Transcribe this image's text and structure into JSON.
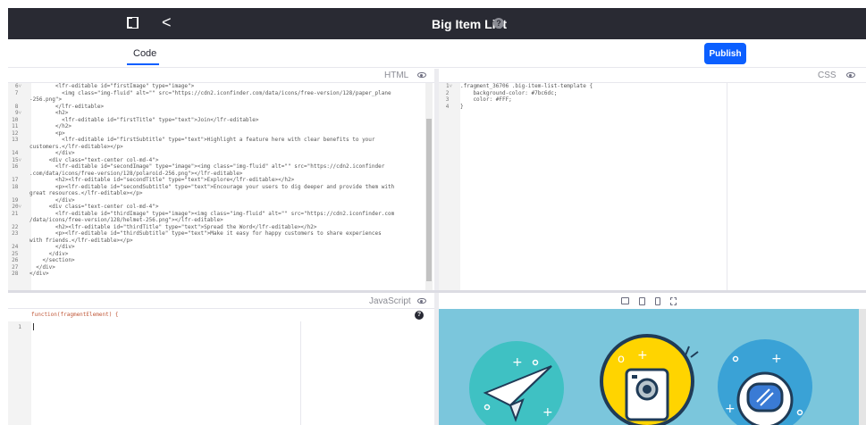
{
  "topbar": {
    "title": "Big Item List",
    "toggle_icon": "sidebar-toggle-icon",
    "back_icon": "chevron-left-icon",
    "back_glyph": "<",
    "help_icon": "question-circle-icon",
    "help_glyph": "?"
  },
  "tabs": [
    {
      "label": "Code",
      "active": true
    }
  ],
  "publish_label": "Publish",
  "panes": {
    "html": {
      "label": "HTML"
    },
    "css": {
      "label": "CSS"
    },
    "js": {
      "label": "JavaScript"
    }
  },
  "html_code": [
    {
      "n": "6",
      "fold": true,
      "t": "        <lfr-editable id=\"firstImage\" type=\"image\">"
    },
    {
      "n": "7",
      "fold": false,
      "t": "          <img class=\"img-fluid\" alt=\"\" src=\"https://cdn2.iconfinder.com/data/icons/free-version/128/paper_plane"
    },
    {
      "n": "",
      "fold": false,
      "t": "-256.png\">"
    },
    {
      "n": "8",
      "fold": false,
      "t": "        </lfr-editable>"
    },
    {
      "n": "9",
      "fold": true,
      "t": "        <h2>"
    },
    {
      "n": "10",
      "fold": false,
      "t": "          <lfr-editable id=\"firstTitle\" type=\"text\">Join</lfr-editable>"
    },
    {
      "n": "11",
      "fold": false,
      "t": "        </h2>"
    },
    {
      "n": "12",
      "fold": false,
      "t": "        <p>"
    },
    {
      "n": "13",
      "fold": false,
      "t": "          <lfr-editable id=\"firstSubtitle\" type=\"text\">Highlight a feature here with clear benefits to your"
    },
    {
      "n": "",
      "fold": false,
      "t": "customers.</lfr-editable></p>"
    },
    {
      "n": "14",
      "fold": false,
      "t": "        </div>"
    },
    {
      "n": "15",
      "fold": true,
      "t": "      <div class=\"text-center col-md-4\">"
    },
    {
      "n": "16",
      "fold": false,
      "t": "        <lfr-editable id=\"secondImage\" type=\"image\"><img class=\"img-fluid\" alt=\"\" src=\"https://cdn2.iconfinder"
    },
    {
      "n": "",
      "fold": false,
      "t": ".com/data/icons/free-version/128/polaroid-256.png\"></lfr-editable>"
    },
    {
      "n": "17",
      "fold": false,
      "t": "        <h2><lfr-editable id=\"secondTitle\" type=\"text\">Explore</lfr-editable></h2>"
    },
    {
      "n": "18",
      "fold": false,
      "t": "        <p><lfr-editable id=\"secondSubtitle\" type=\"text\">Encourage your users to dig deeper and provide them with"
    },
    {
      "n": "",
      "fold": false,
      "t": "great resources.</lfr-editable></p>"
    },
    {
      "n": "19",
      "fold": false,
      "t": "        </div>"
    },
    {
      "n": "20",
      "fold": true,
      "t": "      <div class=\"text-center col-md-4\">"
    },
    {
      "n": "21",
      "fold": false,
      "t": "        <lfr-editable id=\"thirdImage\" type=\"image\"><img class=\"img-fluid\" alt=\"\" src=\"https://cdn2.iconfinder.com"
    },
    {
      "n": "",
      "fold": false,
      "t": "/data/icons/free-version/128/helmet-256.png\"></lfr-editable>"
    },
    {
      "n": "22",
      "fold": false,
      "t": "        <h2><lfr-editable id=\"thirdTitle\" type=\"text\">Spread the Word</lfr-editable></h2>"
    },
    {
      "n": "23",
      "fold": false,
      "t": "        <p><lfr-editable id=\"thirdSubtitle\" type=\"text\">Make it easy for happy customers to share experiences"
    },
    {
      "n": "",
      "fold": false,
      "t": "with friends.</lfr-editable></p>"
    },
    {
      "n": "24",
      "fold": false,
      "t": "        </div>"
    },
    {
      "n": "25",
      "fold": false,
      "t": "      </div>"
    },
    {
      "n": "26",
      "fold": false,
      "t": "    </section>"
    },
    {
      "n": "27",
      "fold": false,
      "t": "  </div>"
    },
    {
      "n": "28",
      "fold": false,
      "t": "</div>"
    }
  ],
  "css_code": [
    {
      "n": "1",
      "fold": true,
      "t": ".fragment_36706 .big-item-list-template {"
    },
    {
      "n": "2",
      "fold": false,
      "t": "    background-color: #7bc6dc;"
    },
    {
      "n": "3",
      "fold": false,
      "t": "    color: #FFF;"
    },
    {
      "n": "4",
      "fold": false,
      "t": "}"
    }
  ],
  "js": {
    "header": "function(fragmentElement) {",
    "line_number": "1"
  },
  "preview": {
    "background": "#7bc6dc",
    "devices": [
      "desktop-icon",
      "tablet-icon",
      "mobile-icon",
      "custom-size-icon"
    ]
  },
  "colors": {
    "topbar": "#292a33",
    "accent": "#0b5fff",
    "preview_bg": "#7bc6dc"
  }
}
